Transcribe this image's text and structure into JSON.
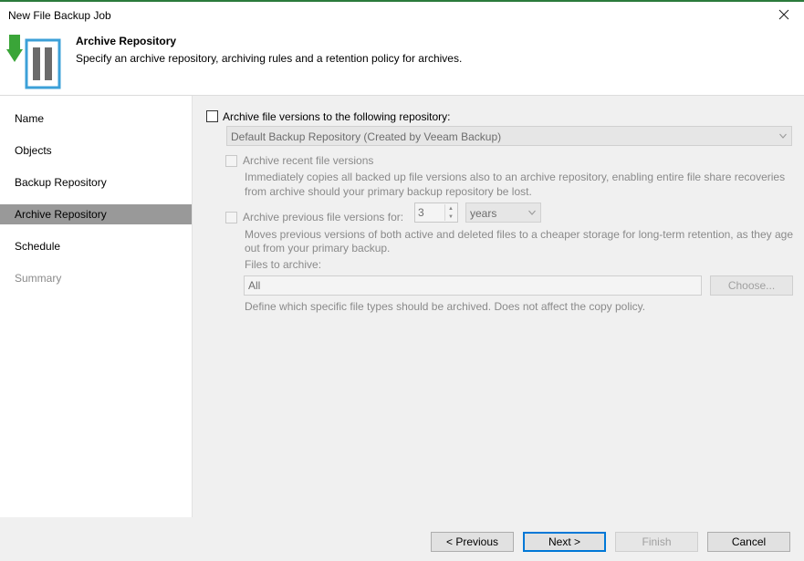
{
  "window": {
    "title": "New File Backup Job",
    "close_icon": "close-icon",
    "accent": "#2b7a3b"
  },
  "header": {
    "title": "Archive Repository",
    "subtitle": "Specify an archive repository, archiving rules and a retention policy for archives.",
    "icon": "archive-download-icon"
  },
  "sidebar": {
    "items": [
      {
        "label": "Name",
        "state": "normal"
      },
      {
        "label": "Objects",
        "state": "normal"
      },
      {
        "label": "Backup Repository",
        "state": "normal"
      },
      {
        "label": "Archive Repository",
        "state": "active"
      },
      {
        "label": "Schedule",
        "state": "normal"
      },
      {
        "label": "Summary",
        "state": "disabled"
      }
    ]
  },
  "archive": {
    "checkbox_label": "Archive file versions to the following repository:",
    "checked": false,
    "repository": "Default Backup Repository (Created by Veeam Backup)",
    "recent": {
      "label": "Archive recent file versions",
      "description_line1": "Immediately copies all backed up file versions also to an archive repository, enabling entire file share recoveries",
      "description_line2": "from archive should your primary backup repository be lost."
    },
    "previous": {
      "label": "Archive previous file versions for:",
      "value": "3",
      "unit": "years",
      "description_line1": "Moves previous versions of both active and deleted files to a cheaper storage for long-term retention, as they age",
      "description_line2": "out from your primary backup."
    },
    "files": {
      "label": "Files to archive:",
      "value": "All",
      "choose_label": "Choose...",
      "description": "Define which specific file types should be archived. Does not affect the copy policy."
    }
  },
  "footer": {
    "previous_label": "< Previous",
    "next_label": "Next >",
    "finish_label": "Finish",
    "cancel_label": "Cancel"
  }
}
